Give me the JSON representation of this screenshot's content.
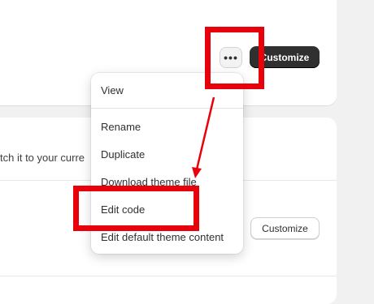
{
  "theme_card": {
    "more_label": "•••",
    "customize_label": "Customize"
  },
  "second_card": {
    "description": "tch it to your curre",
    "customize_label": "Customize"
  },
  "menu": {
    "items": [
      "View",
      "Rename",
      "Duplicate",
      "Download theme file",
      "Edit code",
      "Edit default theme content"
    ]
  },
  "annotation": {
    "color": "#e8000b"
  }
}
